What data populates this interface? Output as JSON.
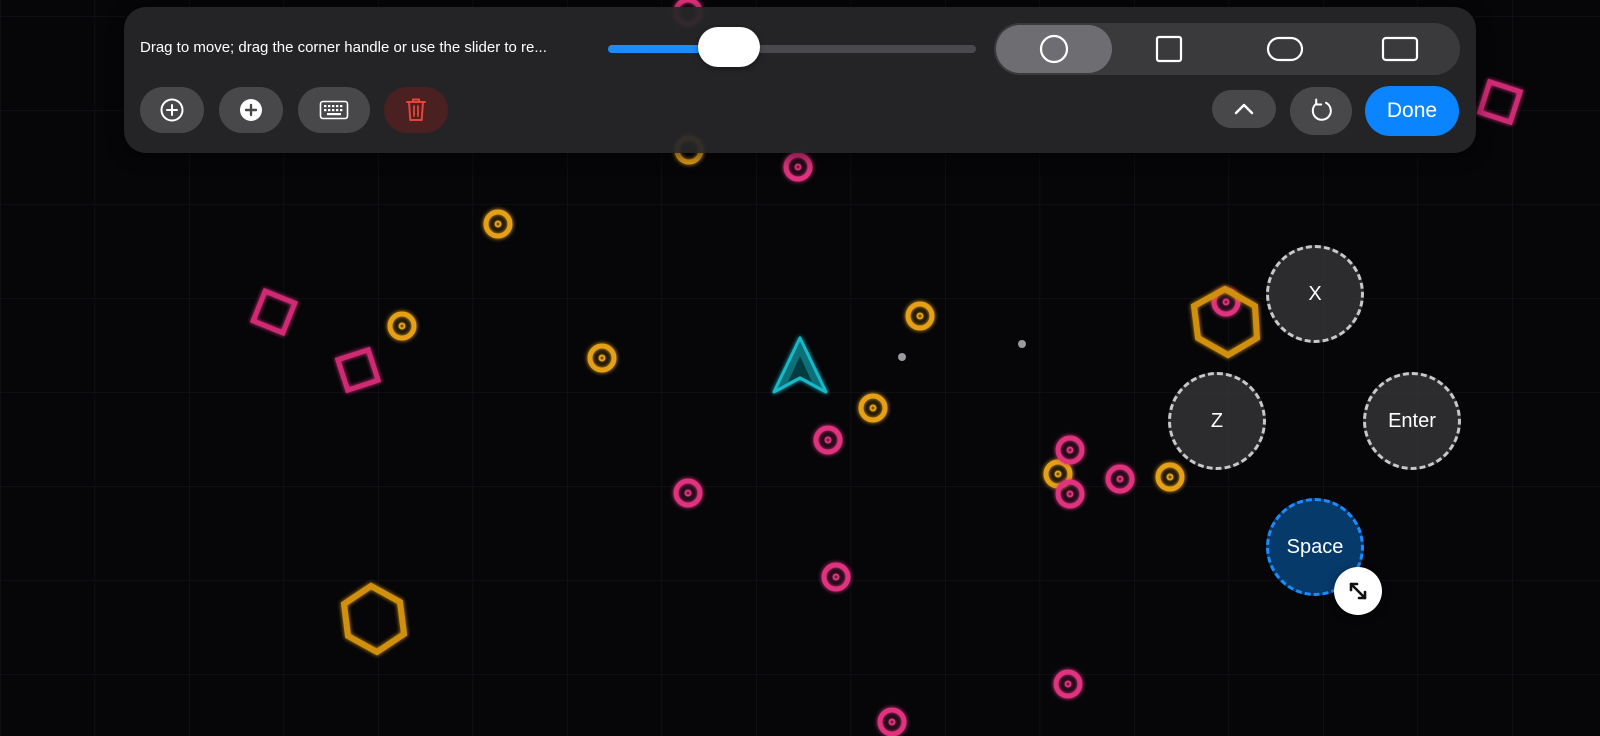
{
  "editor": {
    "hint": "Drag to move; drag the corner handle or use the slider to re...",
    "size_slider_fraction": 0.33,
    "shapes": [
      {
        "name": "circle",
        "selected": true
      },
      {
        "name": "square",
        "selected": false
      },
      {
        "name": "pill",
        "selected": false
      },
      {
        "name": "rectangle",
        "selected": false
      }
    ],
    "tools": [
      "add-outline-icon",
      "add-filled-icon",
      "keyboard-icon",
      "trash-icon"
    ],
    "done_label": "Done"
  },
  "controls": {
    "x_label": "X",
    "z_label": "Z",
    "enter_label": "Enter",
    "space_label": "Space"
  },
  "colors": {
    "accent": "#0a84ff",
    "pink": "#e0307e",
    "orange": "#e5a014",
    "cyan": "#19b9c9",
    "danger": "#e5443a"
  }
}
